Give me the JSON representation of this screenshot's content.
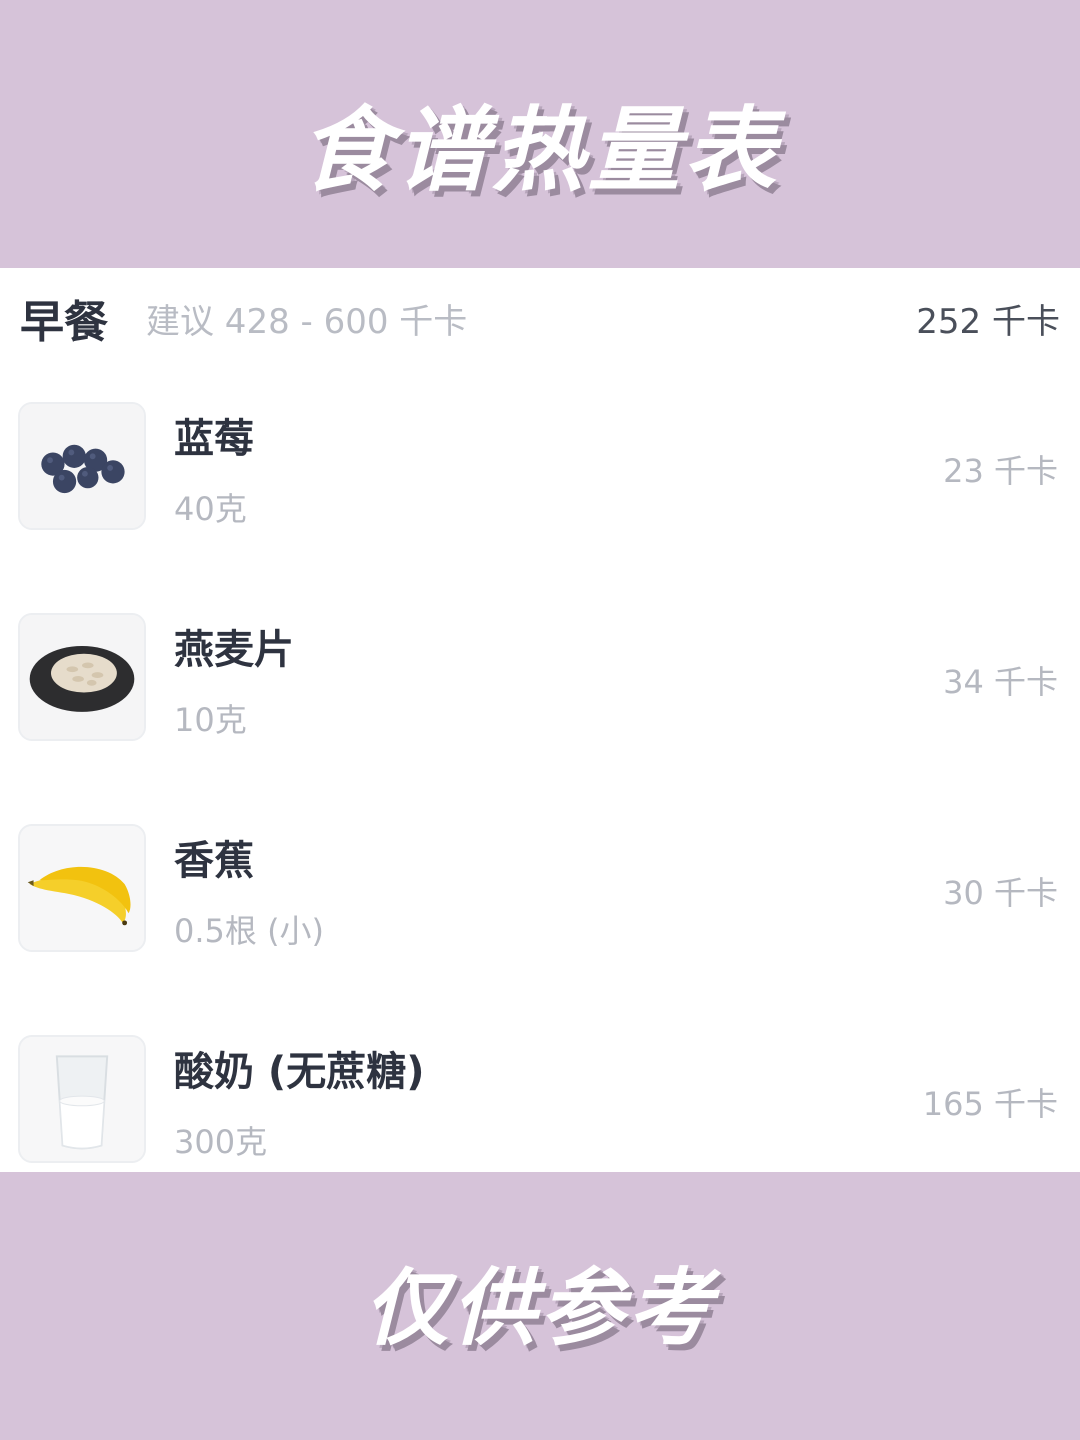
{
  "banner_top": {
    "title": "食谱热量表"
  },
  "banner_bottom": {
    "title": "仅供参考"
  },
  "meal": {
    "title": "早餐",
    "suggestion": "建议 428 - 600 千卡",
    "total": "252 千卡"
  },
  "items": [
    {
      "name": "蓝莓",
      "amount": "40克",
      "kcal": "23 千卡",
      "icon": "blueberries-icon"
    },
    {
      "name": "燕麦片",
      "amount": "10克",
      "kcal": "34 千卡",
      "icon": "oats-icon"
    },
    {
      "name": "香蕉",
      "amount": "0.5根 (小)",
      "kcal": "30 千卡",
      "icon": "banana-icon"
    },
    {
      "name": "酸奶 (无蔗糖)",
      "amount": "300克",
      "kcal": "165 千卡",
      "icon": "yogurt-icon"
    }
  ],
  "colors": {
    "banner_bg": "#d6c3d9",
    "title_text": "#2e3340",
    "muted_text": "#b5b8c0"
  }
}
